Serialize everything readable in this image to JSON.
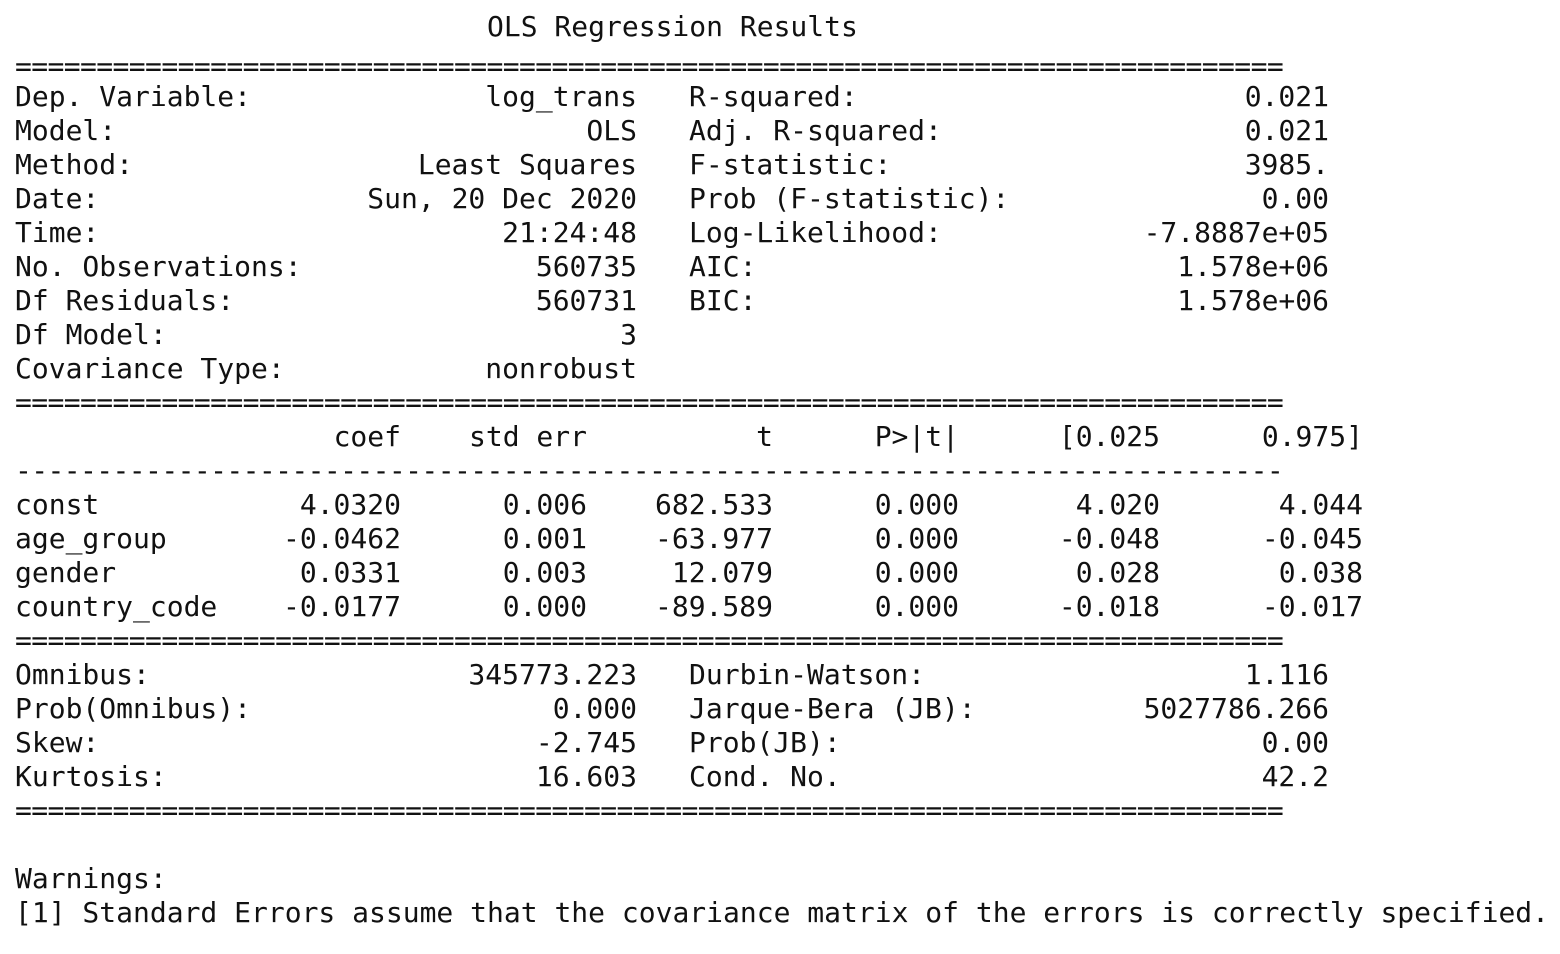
{
  "title": "OLS Regression Results",
  "top_stats": {
    "left": [
      {
        "label": "Dep. Variable:",
        "value": "log_trans"
      },
      {
        "label": "Model:",
        "value": "OLS"
      },
      {
        "label": "Method:",
        "value": "Least Squares"
      },
      {
        "label": "Date:",
        "value": "Sun, 20 Dec 2020"
      },
      {
        "label": "Time:",
        "value": "21:24:48"
      },
      {
        "label": "No. Observations:",
        "value": "560735"
      },
      {
        "label": "Df Residuals:",
        "value": "560731"
      },
      {
        "label": "Df Model:",
        "value": "3"
      },
      {
        "label": "Covariance Type:",
        "value": "nonrobust"
      }
    ],
    "right": [
      {
        "label": "R-squared:",
        "value": "0.021"
      },
      {
        "label": "Adj. R-squared:",
        "value": "0.021"
      },
      {
        "label": "F-statistic:",
        "value": "3985."
      },
      {
        "label": "Prob (F-statistic):",
        "value": "0.00"
      },
      {
        "label": "Log-Likelihood:",
        "value": "-7.8887e+05"
      },
      {
        "label": "AIC:",
        "value": "1.578e+06"
      },
      {
        "label": "BIC:",
        "value": "1.578e+06"
      }
    ]
  },
  "coef_table": {
    "headers": [
      "coef",
      "std err",
      "t",
      "P>|t|",
      "[0.025",
      "0.975]"
    ],
    "rows": [
      {
        "name": "const",
        "values": [
          "4.0320",
          "0.006",
          "682.533",
          "0.000",
          "4.020",
          "4.044"
        ]
      },
      {
        "name": "age_group",
        "values": [
          "-0.0462",
          "0.001",
          "-63.977",
          "0.000",
          "-0.048",
          "-0.045"
        ]
      },
      {
        "name": "gender",
        "values": [
          "0.0331",
          "0.003",
          "12.079",
          "0.000",
          "0.028",
          "0.038"
        ]
      },
      {
        "name": "country_code",
        "values": [
          "-0.0177",
          "0.000",
          "-89.589",
          "0.000",
          "-0.018",
          "-0.017"
        ]
      }
    ]
  },
  "bottom_stats": {
    "left": [
      {
        "label": "Omnibus:",
        "value": "345773.223"
      },
      {
        "label": "Prob(Omnibus):",
        "value": "0.000"
      },
      {
        "label": "Skew:",
        "value": "-2.745"
      },
      {
        "label": "Kurtosis:",
        "value": "16.603"
      }
    ],
    "right": [
      {
        "label": "Durbin-Watson:",
        "value": "1.116"
      },
      {
        "label": "Jarque-Bera (JB):",
        "value": "5027786.266"
      },
      {
        "label": "Prob(JB):",
        "value": "0.00"
      },
      {
        "label": "Cond. No.",
        "value": "42.2"
      }
    ]
  },
  "warnings": {
    "heading": "Warnings:",
    "items": [
      "[1] Standard Errors assume that the covariance matrix of the errors is correctly specified."
    ]
  },
  "separators": {
    "double": "==============================================================================",
    "single": "------------------------------------------------------------------------------"
  }
}
